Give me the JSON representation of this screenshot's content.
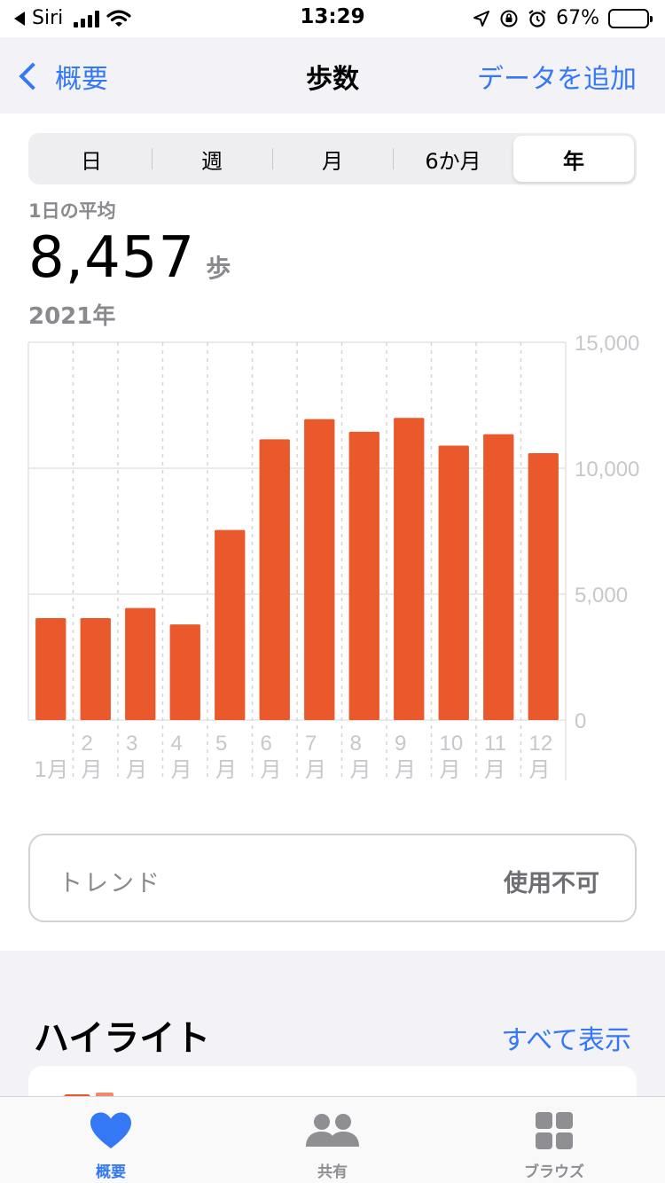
{
  "status_bar": {
    "carrier": "Siri",
    "time": "13:29",
    "battery_percent": "67%",
    "battery_level": 0.67
  },
  "nav": {
    "back_label": "概要",
    "title": "歩数",
    "action_label": "データを追加"
  },
  "segments": [
    {
      "label": "日",
      "selected": false
    },
    {
      "label": "週",
      "selected": false
    },
    {
      "label": "月",
      "selected": false
    },
    {
      "label": "6か月",
      "selected": false
    },
    {
      "label": "年",
      "selected": true
    }
  ],
  "summary": {
    "avg_label": "1日の平均",
    "avg_value": "8,457",
    "unit": "歩",
    "period": "2021年"
  },
  "chart_data": {
    "type": "bar",
    "categories": [
      "1月",
      "2月",
      "3月",
      "4月",
      "5月",
      "6月",
      "7月",
      "8月",
      "9月",
      "10月",
      "11月",
      "12月"
    ],
    "tick_labels": [
      [
        "",
        "1月"
      ],
      [
        "2",
        "月"
      ],
      [
        "3",
        "月"
      ],
      [
        "4",
        "月"
      ],
      [
        "5",
        "月"
      ],
      [
        "6",
        "月"
      ],
      [
        "7",
        "月"
      ],
      [
        "8",
        "月"
      ],
      [
        "9",
        "月"
      ],
      [
        "10",
        "月"
      ],
      [
        "11",
        "月"
      ],
      [
        "12",
        "月"
      ]
    ],
    "values": [
      4050,
      4050,
      4450,
      3800,
      7550,
      11150,
      11950,
      11450,
      12000,
      10900,
      11350,
      10600
    ],
    "ylim": [
      0,
      15000
    ],
    "yticks": [
      0,
      5000,
      10000,
      15000
    ],
    "ytick_labels": [
      "0",
      "5,000",
      "10,000",
      "15,000"
    ],
    "bar_color": "#e9592b",
    "grid": true
  },
  "trend": {
    "label": "トレンド",
    "status": "使用不可"
  },
  "highlights": {
    "title": "ハイライト",
    "show_all": "すべて表示"
  },
  "tabs": [
    {
      "label": "概要",
      "icon": "heart-icon",
      "active": true
    },
    {
      "label": "共有",
      "icon": "people-icon",
      "active": false
    },
    {
      "label": "ブラウズ",
      "icon": "grid-icon",
      "active": false
    }
  ],
  "colors": {
    "accent": "#3478f6",
    "bar": "#e9592b",
    "secondary_text": "#8a8a8e"
  }
}
